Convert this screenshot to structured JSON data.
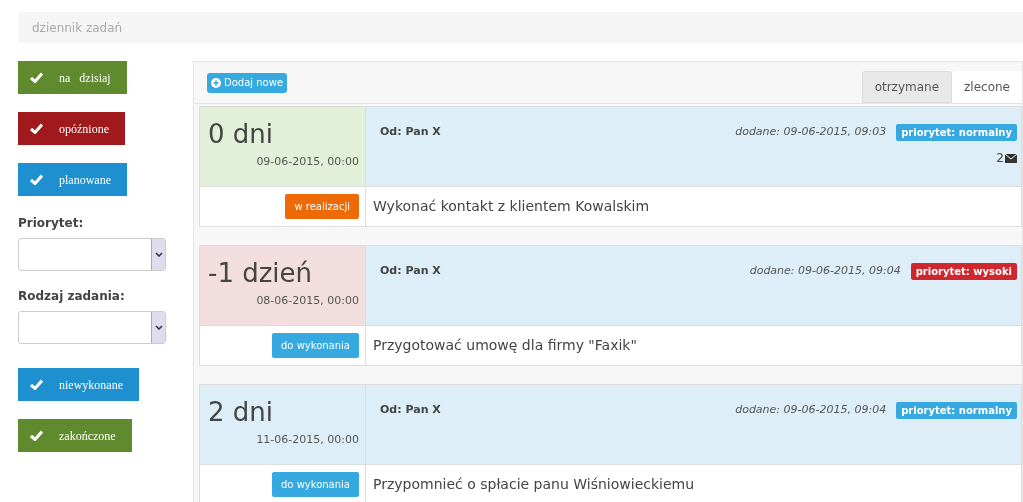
{
  "breadcrumb": "dziennik zadań",
  "filters_top": [
    {
      "label": "na   dzisiaj",
      "color": "#5f8a2e"
    },
    {
      "label": "opóźnione",
      "color": "#a0191d"
    },
    {
      "label": "planowane",
      "color": "#1e90cf"
    }
  ],
  "selects": [
    {
      "label": "Priorytet:"
    },
    {
      "label": "Rodzaj zadania:"
    }
  ],
  "filters_bottom": [
    {
      "label": "niewykonane",
      "color": "#1e90cf"
    },
    {
      "label": "zakończone",
      "color": "#5f8a2e"
    }
  ],
  "add_button": "Dodaj nowe",
  "tabs": [
    {
      "label": "otrzymane",
      "selected": true
    },
    {
      "label": "zlecone",
      "selected": false
    }
  ],
  "tasks": [
    {
      "days": "0 dni",
      "deadline": "09-06-2015, 00:00",
      "color": "#e2f0d9",
      "from": "Od: Pan X",
      "added": "dodane: 09-06-2015, 09:03",
      "priority": {
        "label": "priorytet: normalny",
        "kind": "normal"
      },
      "messages": "2",
      "status": {
        "label": "w realizacji",
        "kind": "in_progress"
      },
      "title": "Wykonać kontakt z klientem Kowalskim"
    },
    {
      "days": "-1 dzień",
      "deadline": "08-06-2015, 00:00",
      "color": "#f2dede",
      "from": "Od: Pan X",
      "added": "dodane: 09-06-2015, 09:04",
      "priority": {
        "label": "priorytet: wysoki",
        "kind": "high"
      },
      "status": {
        "label": "do wykonania",
        "kind": "todo"
      },
      "title": "Przygotować umowę dla firmy \"Faxik\""
    },
    {
      "days": "2 dni",
      "deadline": "11-06-2015, 00:00",
      "color": "#ddeef8",
      "from": "Od: Pan X",
      "added": "dodane: 09-06-2015, 09:04",
      "priority": {
        "label": "priorytet: normalny",
        "kind": "normal"
      },
      "status": {
        "label": "do wykonania",
        "kind": "todo"
      },
      "title": "Przypomnieć o spłacie panu Wiśniowieckiemu"
    }
  ]
}
